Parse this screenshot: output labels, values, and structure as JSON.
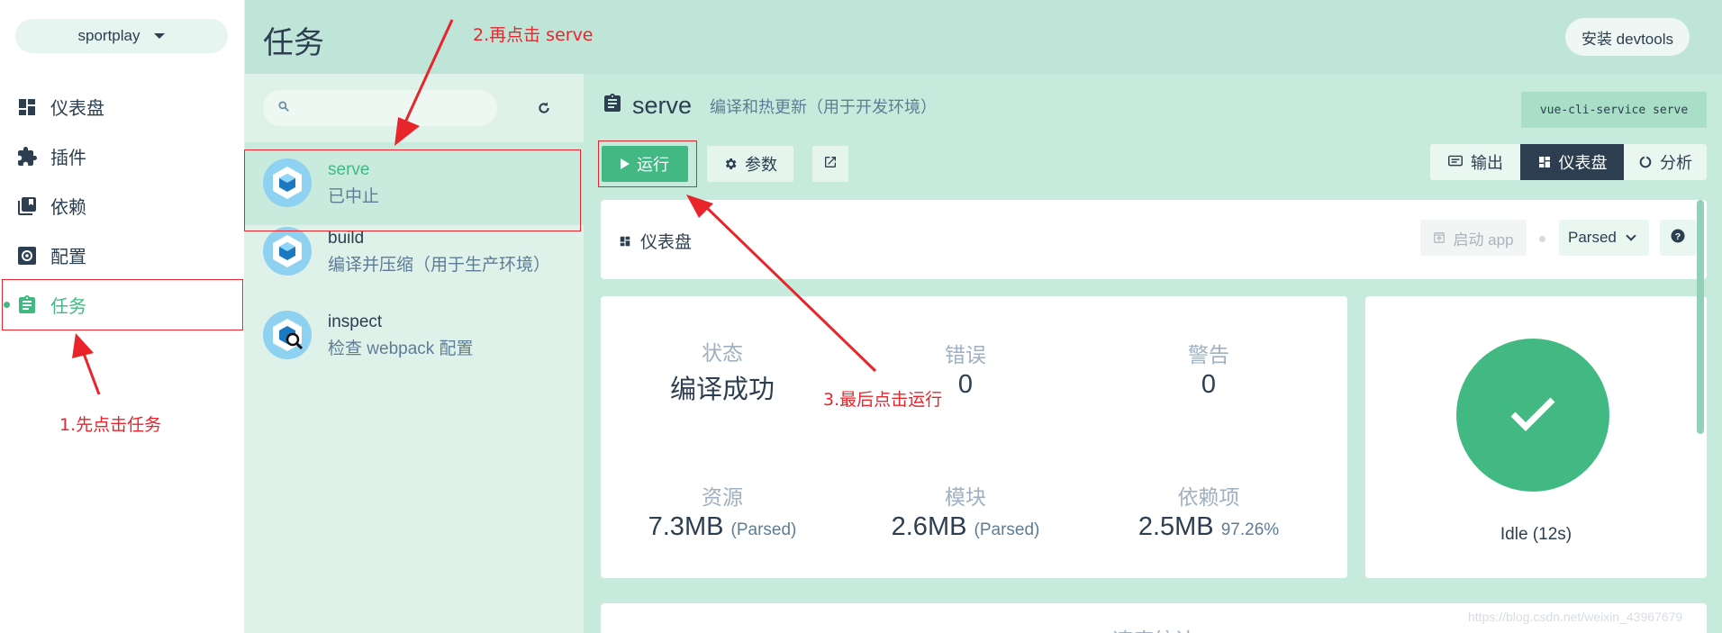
{
  "project": {
    "name": "sportplay"
  },
  "nav": {
    "items": [
      {
        "label": "仪表盘",
        "icon": "dashboard-icon"
      },
      {
        "label": "插件",
        "icon": "puzzle-icon"
      },
      {
        "label": "依赖",
        "icon": "library-icon"
      },
      {
        "label": "配置",
        "icon": "settings-icon"
      },
      {
        "label": "任务",
        "icon": "clipboard-icon",
        "active": true
      }
    ]
  },
  "header": {
    "title": "任务",
    "devtools_label": "安装 devtools"
  },
  "tasks": [
    {
      "name": "serve",
      "desc": "已中止",
      "selected": true
    },
    {
      "name": "build",
      "desc": "编译并压缩（用于生产环境）"
    },
    {
      "name": "inspect",
      "desc": "检查 webpack 配置"
    }
  ],
  "task_detail": {
    "name": "serve",
    "description": "编译和热更新（用于开发环境）",
    "command": "vue-cli-service serve",
    "run_label": "运行",
    "params_label": "参数",
    "views": {
      "output": "输出",
      "dashboard": "仪表盘",
      "analyze": "分析"
    }
  },
  "dashboard": {
    "title": "仪表盘",
    "start_app_label": "启动 app",
    "mode": "Parsed",
    "stats": {
      "status": {
        "label": "状态",
        "value": "编译成功"
      },
      "errors": {
        "label": "错误",
        "value": "0"
      },
      "warnings": {
        "label": "警告",
        "value": "0"
      },
      "assets": {
        "label": "资源",
        "value": "7.3MB",
        "sub": "(Parsed)"
      },
      "modules": {
        "label": "模块",
        "value": "2.6MB",
        "sub": "(Parsed)"
      },
      "deps": {
        "label": "依赖项",
        "value": "2.5MB",
        "sub": "97.26%"
      }
    },
    "status_text": "Idle (12s)",
    "speed_title": "速度统计"
  },
  "annotations": {
    "step1": "1.先点击任务",
    "step2": "2.再点击 serve",
    "step3": "3.最后点击运行"
  },
  "watermark": "https://blog.csdn.net/weixin_43967679",
  "colors": {
    "accent": "#42b983",
    "dark": "#2c3e50",
    "annotation": "#e8252b"
  }
}
